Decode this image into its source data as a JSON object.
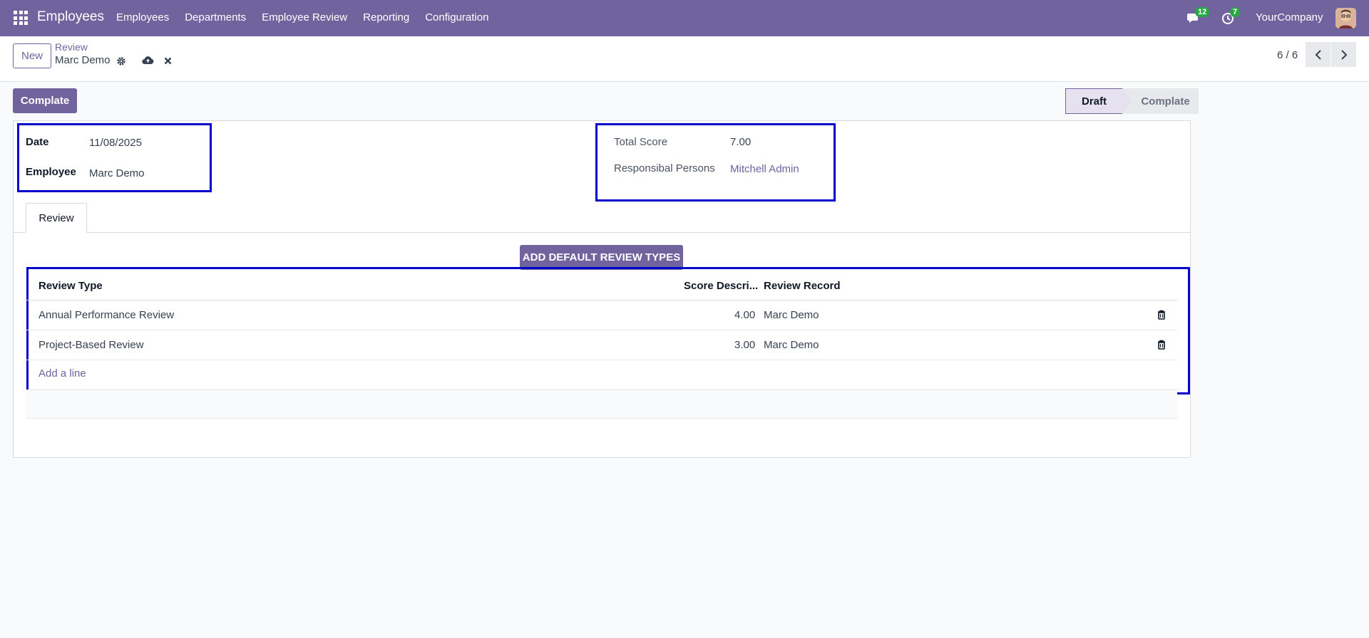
{
  "navbar": {
    "app_title": "Employees",
    "menu": [
      "Employees",
      "Departments",
      "Employee Review",
      "Reporting",
      "Configuration"
    ],
    "messages_badge": "12",
    "activity_badge": "7",
    "company": "YourCompany"
  },
  "control_panel": {
    "new_label": "New",
    "breadcrumb_parent": "Review",
    "breadcrumb_current": "Marc Demo",
    "pager": "6 / 6"
  },
  "actions": {
    "complete_label": "Complate"
  },
  "statusbar": {
    "stages": [
      "Draft",
      "Complate"
    ],
    "active": "Draft"
  },
  "form": {
    "date_label": "Date",
    "date_value": "11/08/2025",
    "employee_label": "Employee",
    "employee_value": "Marc Demo",
    "total_score_label": "Total Score",
    "total_score_value": "7.00",
    "responsible_label": "Responsibal Persons",
    "responsible_value": "Mitchell Admin"
  },
  "tabs": [
    "Review"
  ],
  "review": {
    "add_default_label": "ADD DEFAULT REVIEW TYPES",
    "columns": [
      "Review Type",
      "Score Descri...",
      "Review Record"
    ],
    "rows": [
      {
        "type": "Annual Performance Review",
        "score": "4.00",
        "record": "Marc Demo"
      },
      {
        "type": "Project-Based Review",
        "score": "3.00",
        "record": "Marc Demo"
      }
    ],
    "add_line_label": "Add a line"
  },
  "colors": {
    "brand": "#71639e",
    "highlight": "#0000cc"
  }
}
